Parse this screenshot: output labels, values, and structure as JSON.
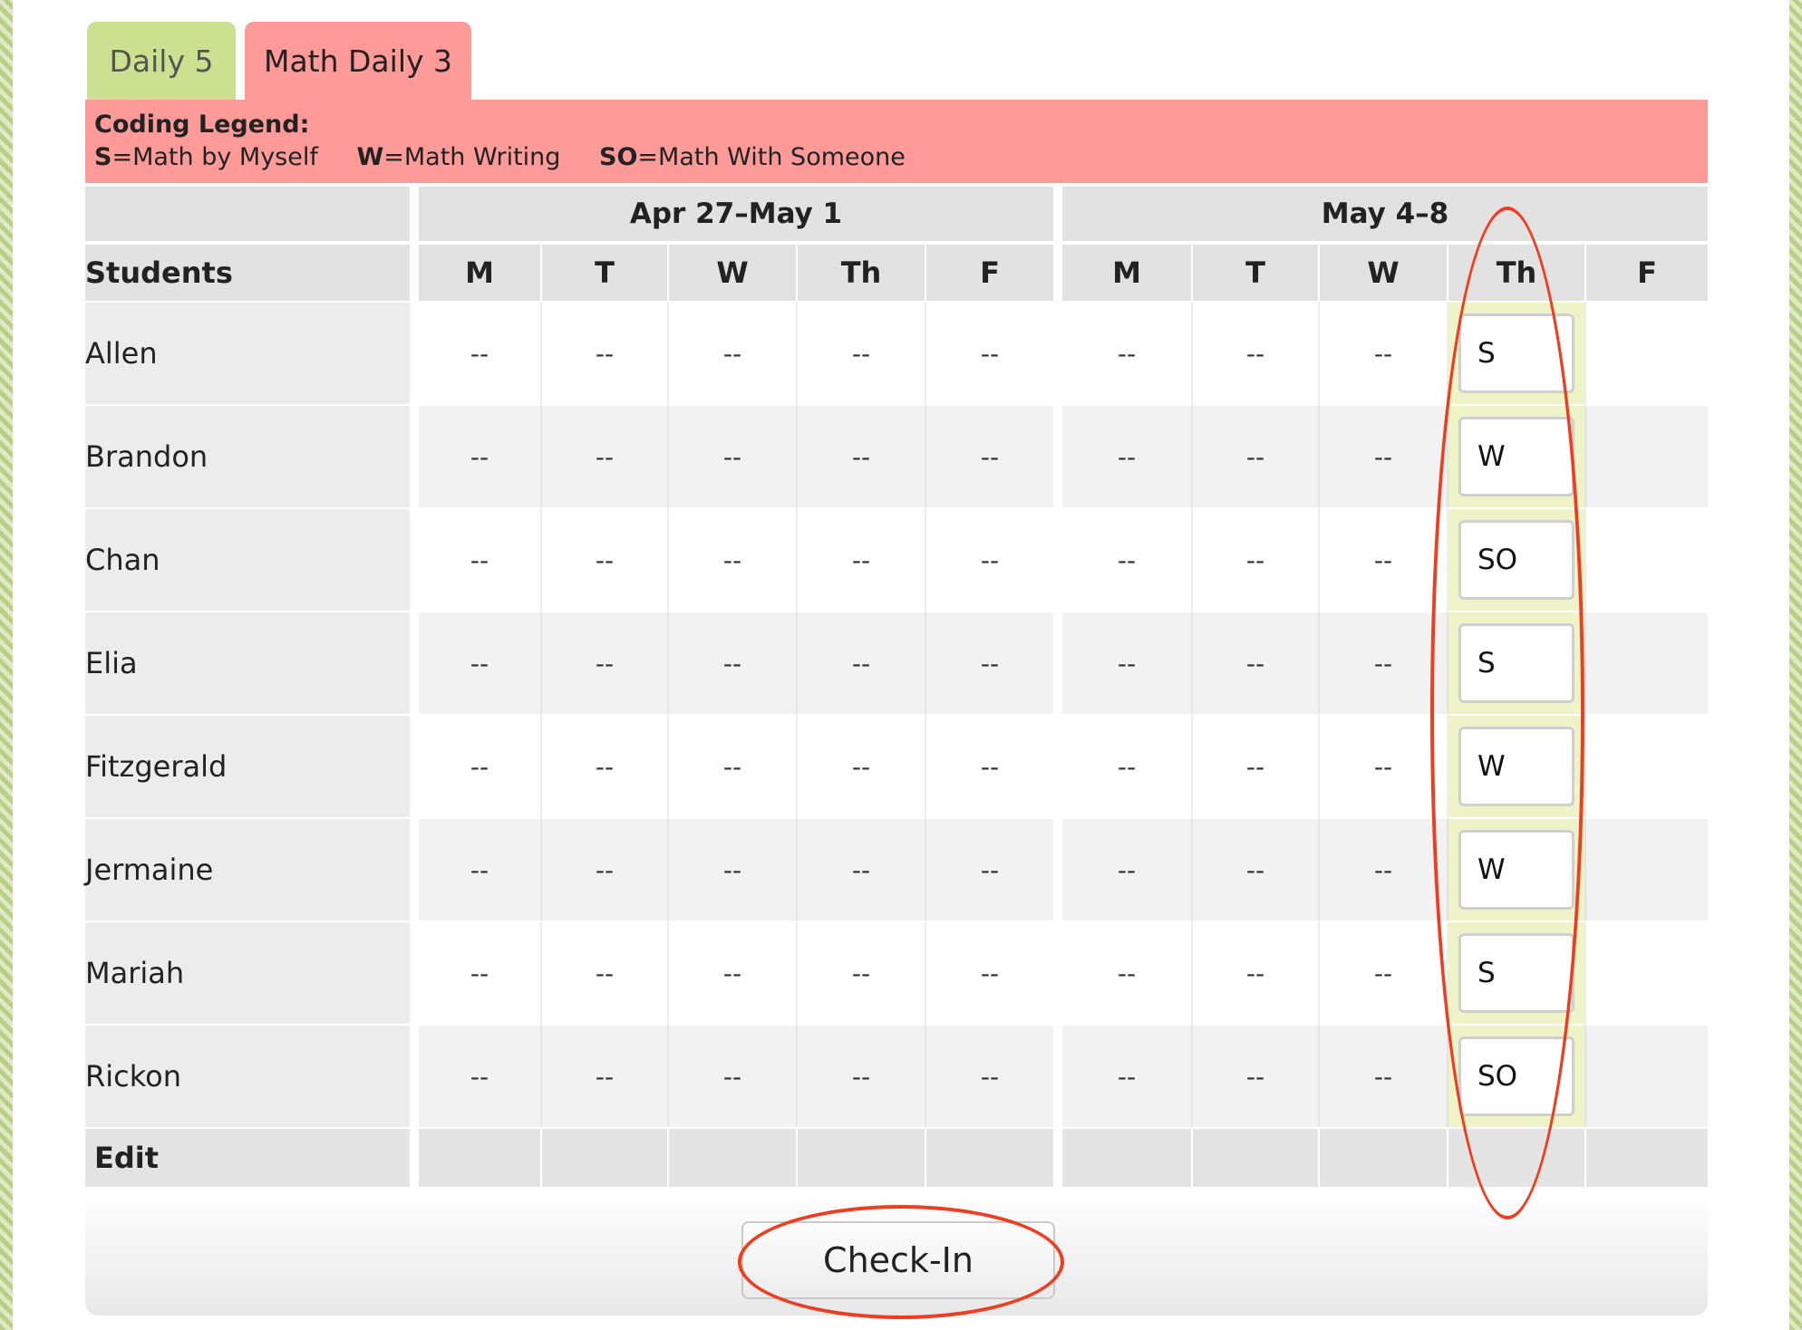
{
  "tabs": [
    {
      "label": "Daily 5"
    },
    {
      "label": "Math Daily 3"
    }
  ],
  "legend": {
    "title": "Coding Legend:",
    "items": [
      {
        "code": "S",
        "desc": "=Math by Myself"
      },
      {
        "code": "W",
        "desc": "=Math Writing"
      },
      {
        "code": "SO",
        "desc": "=Math With Someone"
      }
    ]
  },
  "table": {
    "weeks": [
      "Apr 27–May 1",
      "May 4–8"
    ],
    "students_header": "Students",
    "days": [
      "M",
      "T",
      "W",
      "Th",
      "F",
      "M",
      "T",
      "W",
      "Th",
      "F"
    ],
    "empty_mark": "--",
    "rows": [
      {
        "name": "Allen",
        "code": "S"
      },
      {
        "name": "Brandon",
        "code": "W"
      },
      {
        "name": "Chan",
        "code": "SO"
      },
      {
        "name": "Elia",
        "code": "S"
      },
      {
        "name": "Fitzgerald",
        "code": "W"
      },
      {
        "name": "Jermaine",
        "code": "W"
      },
      {
        "name": "Mariah",
        "code": "S"
      },
      {
        "name": "Rickon",
        "code": "SO"
      }
    ],
    "edit_label": "Edit"
  },
  "checkin_label": "Check-In",
  "colors": {
    "tab_active": "#fe9a98",
    "tab_inactive": "#cbe190",
    "highlight": "#eef4c8",
    "annotation": "#ee3e21"
  }
}
